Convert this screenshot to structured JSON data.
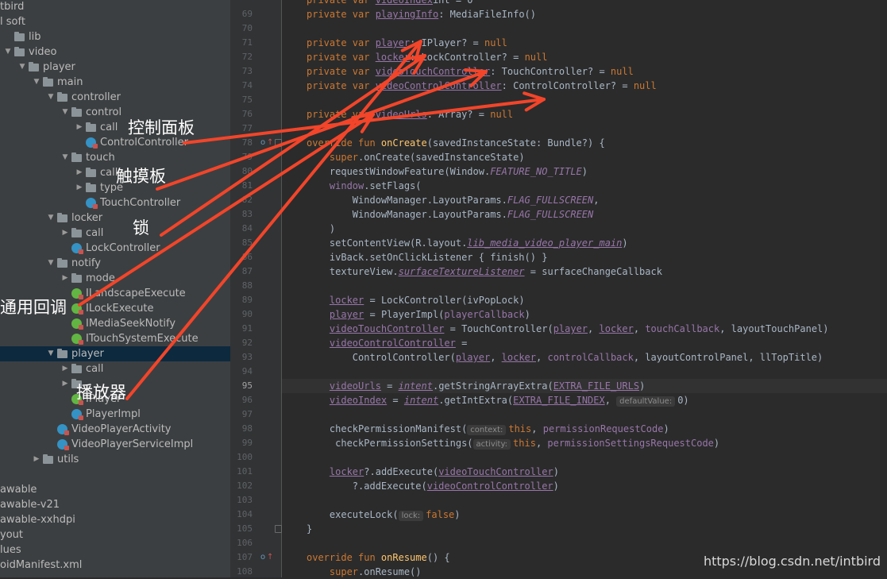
{
  "tree": [
    {
      "label": "tbird",
      "indent": -16,
      "kind": "none",
      "arrow": ""
    },
    {
      "label": "l soft",
      "indent": -16,
      "kind": "none",
      "arrow": ""
    },
    {
      "label": "lib",
      "indent": 4,
      "kind": "folder",
      "arrow": ""
    },
    {
      "label": "video",
      "indent": 4,
      "kind": "folder",
      "arrow": "▼"
    },
    {
      "label": "player",
      "indent": 22,
      "kind": "folder",
      "arrow": "▼"
    },
    {
      "label": "main",
      "indent": 40,
      "kind": "folder",
      "arrow": "▼"
    },
    {
      "label": "controller",
      "indent": 58,
      "kind": "folder",
      "arrow": "▼"
    },
    {
      "label": "control",
      "indent": 76,
      "kind": "folder",
      "arrow": "▼"
    },
    {
      "label": "call",
      "indent": 94,
      "kind": "folder",
      "arrow": "▶"
    },
    {
      "label": "ControlController",
      "indent": 94,
      "kind": "class",
      "arrow": ""
    },
    {
      "label": "touch",
      "indent": 76,
      "kind": "folder",
      "arrow": "▼"
    },
    {
      "label": "call",
      "indent": 94,
      "kind": "folder",
      "arrow": "▶"
    },
    {
      "label": "type",
      "indent": 94,
      "kind": "folder",
      "arrow": "▶"
    },
    {
      "label": "TouchController",
      "indent": 94,
      "kind": "class",
      "arrow": ""
    },
    {
      "label": "locker",
      "indent": 58,
      "kind": "folder",
      "arrow": "▼"
    },
    {
      "label": "call",
      "indent": 76,
      "kind": "folder",
      "arrow": "▶"
    },
    {
      "label": "LockController",
      "indent": 76,
      "kind": "class",
      "arrow": ""
    },
    {
      "label": "notify",
      "indent": 58,
      "kind": "folder",
      "arrow": "▼"
    },
    {
      "label": "mode",
      "indent": 76,
      "kind": "folder",
      "arrow": "▶"
    },
    {
      "label": "ILandscapeExecute",
      "indent": 76,
      "kind": "iface",
      "arrow": ""
    },
    {
      "label": "ILockExecute",
      "indent": 76,
      "kind": "iface",
      "arrow": ""
    },
    {
      "label": "IMediaSeekNotify",
      "indent": 76,
      "kind": "iface",
      "arrow": ""
    },
    {
      "label": "ITouchSystemExecute",
      "indent": 76,
      "kind": "iface",
      "arrow": ""
    },
    {
      "label": "player",
      "indent": 58,
      "kind": "folder",
      "arrow": "▼",
      "selected": true
    },
    {
      "label": "call",
      "indent": 76,
      "kind": "folder",
      "arrow": "▶"
    },
    {
      "label": "",
      "indent": 76,
      "kind": "folder",
      "arrow": "▶"
    },
    {
      "label": "IPlayer",
      "indent": 76,
      "kind": "iface",
      "arrow": ""
    },
    {
      "label": "PlayerImpl",
      "indent": 76,
      "kind": "class",
      "arrow": ""
    },
    {
      "label": "VideoPlayerActivity",
      "indent": 58,
      "kind": "class",
      "arrow": ""
    },
    {
      "label": "VideoPlayerServiceImpl",
      "indent": 58,
      "kind": "class",
      "arrow": ""
    },
    {
      "label": "utils",
      "indent": 40,
      "kind": "folder",
      "arrow": "▶"
    },
    {
      "label": "",
      "indent": 0,
      "kind": "none",
      "arrow": ""
    },
    {
      "label": "awable",
      "indent": -16,
      "kind": "none",
      "arrow": ""
    },
    {
      "label": "awable-v21",
      "indent": -16,
      "kind": "none",
      "arrow": ""
    },
    {
      "label": "awable-xxhdpi",
      "indent": -16,
      "kind": "none",
      "arrow": ""
    },
    {
      "label": "yout",
      "indent": -16,
      "kind": "none",
      "arrow": ""
    },
    {
      "label": "lues",
      "indent": -16,
      "kind": "none",
      "arrow": ""
    },
    {
      "label": "oidManifest.xml",
      "indent": -16,
      "kind": "none",
      "arrow": ""
    }
  ],
  "line_numbers": [
    "69",
    "70",
    "71",
    "72",
    "73",
    "74",
    "75",
    "76",
    "77",
    "78",
    "79",
    "80",
    "81",
    "82",
    "83",
    "84",
    "85",
    "86",
    "87",
    "88",
    "89",
    "90",
    "91",
    "92",
    "93",
    "94",
    "95",
    "96",
    "97",
    "98",
    "99",
    "100",
    "101",
    "102",
    "103",
    "104",
    "105",
    "106",
    "107",
    "108"
  ],
  "current_line": "95",
  "code": [
    [
      [
        "kw",
        "private var "
      ],
      [
        "prop u",
        "videoIndex"
      ],
      [
        "",
        "int = 0"
      ]
    ],
    [
      [
        "kw",
        "private var "
      ],
      [
        "prop u",
        "playingInfo"
      ],
      [
        "",
        ": MediaFileInfo()"
      ]
    ],
    [],
    [
      [
        "kw",
        "private var "
      ],
      [
        "prop u",
        "player"
      ],
      [
        "",
        ": IPlayer? = "
      ],
      [
        "kw",
        "null"
      ]
    ],
    [
      [
        "kw",
        "private var "
      ],
      [
        "prop u",
        "locker"
      ],
      [
        "",
        ": LockController? = "
      ],
      [
        "kw",
        "null"
      ]
    ],
    [
      [
        "kw",
        "private var "
      ],
      [
        "prop u",
        "videoTouchController"
      ],
      [
        "",
        ": TouchController? = "
      ],
      [
        "kw",
        "null"
      ]
    ],
    [
      [
        "kw",
        "private var "
      ],
      [
        "prop u",
        "videoControlController"
      ],
      [
        "",
        ": ControlController? = "
      ],
      [
        "kw",
        "null"
      ]
    ],
    [],
    [
      [
        "kw",
        "private var "
      ],
      [
        "prop u",
        "videoUrls"
      ],
      [
        "",
        ": Array? = "
      ],
      [
        "kw",
        "null"
      ]
    ],
    [],
    [
      [
        "kw",
        "override fun "
      ],
      [
        "fn",
        "onCreate"
      ],
      [
        "",
        "(savedInstanceState: Bundle?) {"
      ]
    ],
    [
      [
        "",
        "    "
      ],
      [
        "kw",
        "super"
      ],
      [
        "",
        ".onCreate(savedInstanceState)"
      ]
    ],
    [
      [
        "",
        "    requestWindowFeature(Window."
      ],
      [
        "prop it",
        "FEATURE_NO_TITLE"
      ],
      [
        "",
        ")"
      ]
    ],
    [
      [
        "",
        "    "
      ],
      [
        "prop",
        "window"
      ],
      [
        "",
        ".setFlags("
      ]
    ],
    [
      [
        "",
        "        WindowManager.LayoutParams."
      ],
      [
        "prop it",
        "FLAG_FULLSCREEN"
      ],
      [
        "",
        ","
      ]
    ],
    [
      [
        "",
        "        WindowManager.LayoutParams."
      ],
      [
        "prop it",
        "FLAG_FULLSCREEN"
      ]
    ],
    [
      [
        "",
        "    )"
      ]
    ],
    [
      [
        "",
        "    setContentView(R.layout."
      ],
      [
        "prop it u",
        "lib_media_video_player_main"
      ],
      [
        "",
        ")"
      ]
    ],
    [
      [
        "",
        "    ivBack.setOnClickListener { finish() }"
      ]
    ],
    [
      [
        "",
        "    textureView."
      ],
      [
        "prop it u",
        "surfaceTextureListener"
      ],
      [
        "",
        " = surfaceChangeCallback"
      ]
    ],
    [],
    [
      [
        "",
        "    "
      ],
      [
        "prop u",
        "locker"
      ],
      [
        "",
        " = LockController(ivPopLock)"
      ]
    ],
    [
      [
        "",
        "    "
      ],
      [
        "prop u",
        "player"
      ],
      [
        "",
        " = PlayerImpl("
      ],
      [
        "prop",
        "playerCallback"
      ],
      [
        "",
        ")"
      ]
    ],
    [
      [
        "",
        "    "
      ],
      [
        "prop u",
        "videoTouchController"
      ],
      [
        "",
        " = TouchController("
      ],
      [
        "prop u",
        "player"
      ],
      [
        "",
        ", "
      ],
      [
        "prop u",
        "locker"
      ],
      [
        "",
        ", "
      ],
      [
        "prop",
        "touchCallback"
      ],
      [
        "",
        ", layoutTouchPanel)"
      ]
    ],
    [
      [
        "",
        "    "
      ],
      [
        "prop u",
        "videoControlController"
      ],
      [
        "",
        " ="
      ]
    ],
    [
      [
        "",
        "        ControlController("
      ],
      [
        "prop u",
        "player"
      ],
      [
        "",
        ", "
      ],
      [
        "prop u",
        "locker"
      ],
      [
        "",
        ", "
      ],
      [
        "prop",
        "controlCallback"
      ],
      [
        "",
        ", layoutControlPanel, llTopTitle)"
      ]
    ],
    [],
    [
      [
        "",
        "    "
      ],
      [
        "prop u",
        "videoUrls"
      ],
      [
        "",
        " = "
      ],
      [
        "prop it u",
        "intent"
      ],
      [
        "",
        ".getStringArrayExtra("
      ],
      [
        "prop u",
        "EXTRA_FILE_URLS"
      ],
      [
        "",
        ")"
      ]
    ],
    [
      [
        "",
        "    "
      ],
      [
        "prop u",
        "videoIndex"
      ],
      [
        "",
        " = "
      ],
      [
        "prop it u",
        "intent"
      ],
      [
        "",
        ".getIntExtra("
      ],
      [
        "prop u",
        "EXTRA_FILE_INDEX"
      ],
      [
        "",
        ", "
      ],
      [
        "hint",
        "defaultValue:"
      ],
      [
        "",
        "0)"
      ]
    ],
    [],
    [
      [
        "",
        "    checkPermissionManifest("
      ],
      [
        "hint",
        "context:"
      ],
      [
        "kw",
        "this"
      ],
      [
        "",
        ", "
      ],
      [
        "prop",
        "permissionRequestCode"
      ],
      [
        "",
        ")"
      ]
    ],
    [
      [
        "",
        "     checkPermissionSettings("
      ],
      [
        "hint",
        "activity:"
      ],
      [
        "kw",
        "this"
      ],
      [
        "",
        ", "
      ],
      [
        "prop",
        "permissionSettingsRequestCode"
      ],
      [
        "",
        ")"
      ]
    ],
    [],
    [
      [
        "",
        "    "
      ],
      [
        "prop u",
        "locker"
      ],
      [
        "",
        "?.addExecute("
      ],
      [
        "prop u",
        "videoTouchController"
      ],
      [
        "",
        ")"
      ]
    ],
    [
      [
        "",
        "        ?.addExecute("
      ],
      [
        "prop u",
        "videoControlController"
      ],
      [
        "",
        ")"
      ]
    ],
    [],
    [
      [
        "",
        "    executeLock("
      ],
      [
        "hint",
        "lock:"
      ],
      [
        "kw",
        "false"
      ],
      [
        "",
        ")"
      ]
    ],
    [
      [
        "",
        "}"
      ]
    ],
    [],
    [
      [
        "kw",
        "override fun "
      ],
      [
        "fn",
        "onResume"
      ],
      [
        "",
        "() {"
      ]
    ],
    [
      [
        "",
        "    "
      ],
      [
        "kw",
        "super"
      ],
      [
        "",
        ".onResume()"
      ]
    ]
  ],
  "annotations": {
    "control_panel": "控制面板",
    "touch_panel": "触摸板",
    "lock": "锁",
    "common_callback": "通用回调",
    "player": "播放器"
  },
  "watermark": "https://blog.csdn.net/intbird",
  "colors": {
    "arrow": "#f2452a",
    "editor_bg": "#2b2b2b",
    "tree_bg": "#3c3f41",
    "selection": "#0d293e"
  }
}
